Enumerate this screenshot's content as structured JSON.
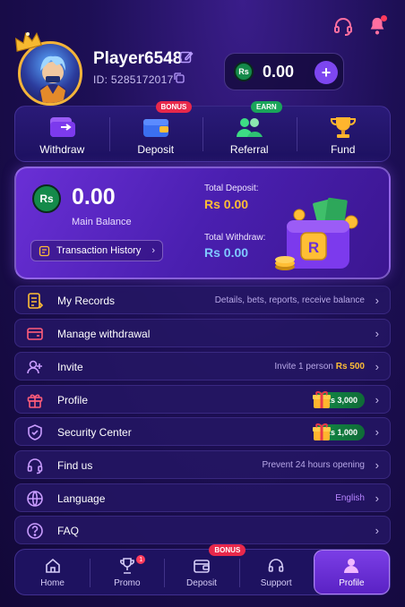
{
  "header": {
    "support_icon": "headset-icon",
    "notification_icon": "bell-icon",
    "player_name": "Player6548",
    "player_id": "ID:  5285172017",
    "balance_currency": "Rs",
    "balance_amount": "0.00",
    "add_label": "+"
  },
  "quick_actions": [
    {
      "label": "Withdraw",
      "icon": "wallet-transfer-icon",
      "tag": ""
    },
    {
      "label": "Deposit",
      "icon": "wallet-icon",
      "tag": "BONUS"
    },
    {
      "label": "Referral",
      "icon": "users-icon",
      "tag": "EARN"
    },
    {
      "label": "Fund",
      "icon": "trophy-icon",
      "tag": ""
    }
  ],
  "balance_card": {
    "currency": "Rs",
    "main_amount": "0.00",
    "main_label": "Main Balance",
    "transaction_history_label": "Transaction History",
    "total_deposit_label": "Total Deposit:",
    "total_deposit_amount": "Rs 0.00",
    "total_withdraw_label": "Total Withdraw:",
    "total_withdraw_amount": "Rs 0.00",
    "wallet_logo_letter": "R"
  },
  "menu": [
    {
      "label": "My Records",
      "icon": "records-icon",
      "right_text": "Details, bets, reports, receive balance"
    },
    {
      "label": "Manage withdrawal",
      "icon": "card-icon",
      "right_text": ""
    },
    {
      "label": "Invite",
      "icon": "invite-icon",
      "right_prefix": "Invite 1 person ",
      "right_amount": "Rs 500"
    },
    {
      "label": "Profile",
      "icon": "gift-icon",
      "reward": "Rs 3,000"
    },
    {
      "label": "Security Center",
      "icon": "shield-icon",
      "reward": "Rs 1,000"
    },
    {
      "label": "Find us",
      "icon": "headset-icon",
      "right_text": "Prevent 24 hours opening"
    },
    {
      "label": "Language",
      "icon": "globe-icon",
      "right_text": "English"
    },
    {
      "label": "FAQ",
      "icon": "question-icon",
      "right_text": ""
    }
  ],
  "bottom_nav": [
    {
      "label": "Home",
      "icon": "home-icon"
    },
    {
      "label": "Promo",
      "icon": "trophy-icon",
      "badge": "1"
    },
    {
      "label": "Deposit",
      "icon": "wallet-icon",
      "tag": "BONUS"
    },
    {
      "label": "Support",
      "icon": "headset-icon"
    },
    {
      "label": "Profile",
      "icon": "user-icon",
      "active": true
    }
  ],
  "colors": {
    "accent": "#7d46f0",
    "gold": "#ffbe35",
    "blue_value": "#7fc8ff",
    "green_reward": "#138a47",
    "badge_red": "#e8284b",
    "earn_green": "#1aa55a"
  }
}
